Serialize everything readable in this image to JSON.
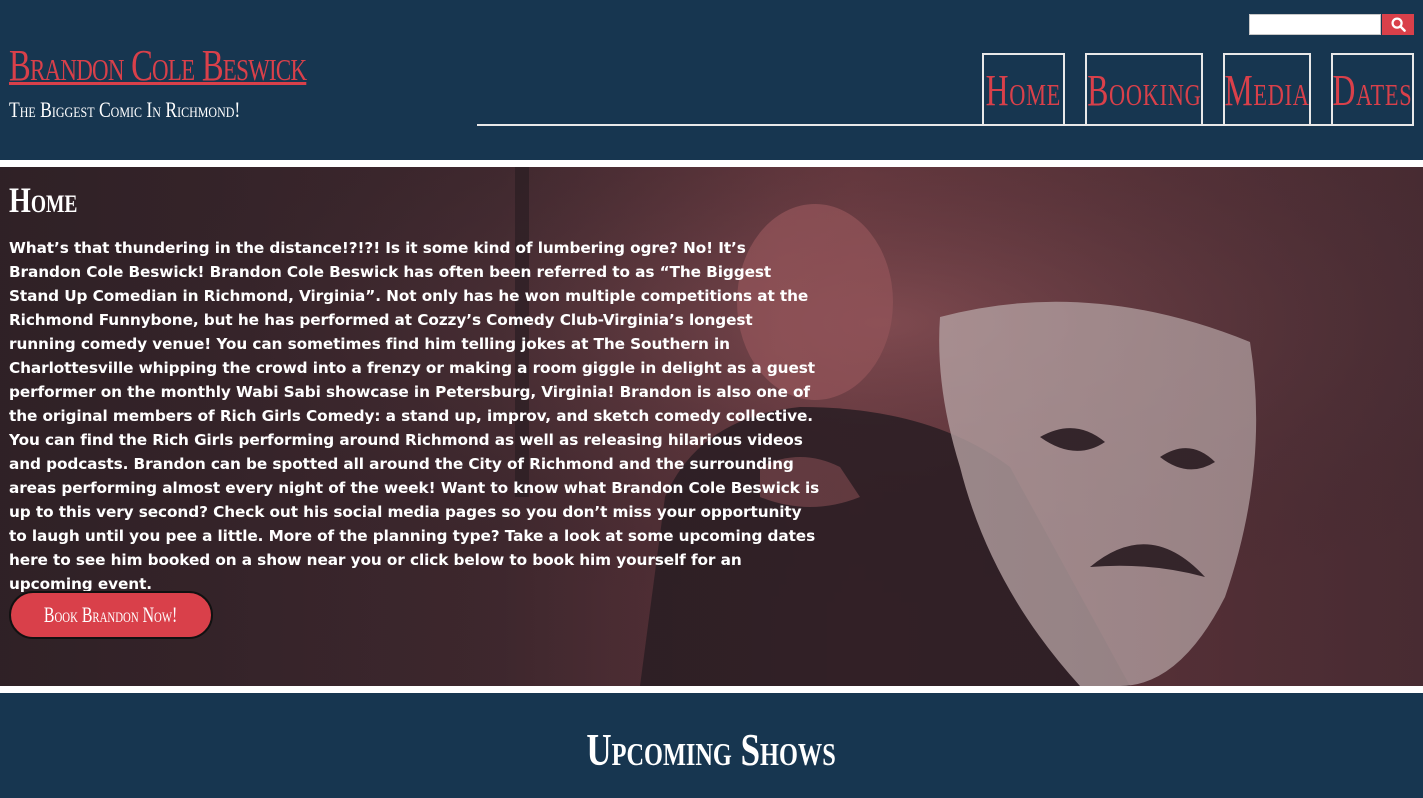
{
  "header": {
    "site_title": "Brandon Cole Beswick",
    "tagline": "The Biggest Comic In Richmond!",
    "search": {
      "value": "",
      "placeholder": "",
      "button_icon": "search-icon"
    }
  },
  "nav": {
    "items": [
      {
        "label": "Home"
      },
      {
        "label": "Booking"
      },
      {
        "label": "Media"
      },
      {
        "label": "Dates"
      }
    ]
  },
  "hero": {
    "heading": "Home",
    "body": "What’s that thundering in the distance!?!?! Is it some kind of lumbering ogre? No! It’s Brandon Cole Beswick! Brandon Cole Beswick has often been referred to as “The Biggest Stand Up Comedian in Richmond, Virginia”. Not only has he won multiple competitions at the Richmond Funnybone, but he has performed at Cozzy’s Comedy Club-Virginia’s longest running comedy venue! You can sometimes find him telling jokes at The Southern in Charlottesville whipping the crowd into a frenzy or making a room giggle in delight as a guest performer on the monthly Wabi Sabi showcase in Petersburg, Virginia! Brandon is also one of the original members of Rich Girls Comedy: a stand up, improv, and sketch comedy collective. You can find the Rich Girls performing around Richmond as well as releasing hilarious videos and podcasts. Brandon can be spotted all around the City of Richmond and the surrounding areas performing almost every night of the week! Want to know what Brandon Cole Beswick is up to this very second? Check out his social media pages so you don’t miss your opportunity to laugh until you pee a little. More of the planning type? Take a look at some upcoming dates here to see him booked on a show near you or click below to book him yourself for an upcoming event.",
    "button_label": "Book Brandon Now!"
  },
  "upcoming": {
    "title": "Upcoming Shows"
  },
  "colors": {
    "background": "#173650",
    "accent": "#d9404a",
    "text": "#ffffff"
  }
}
